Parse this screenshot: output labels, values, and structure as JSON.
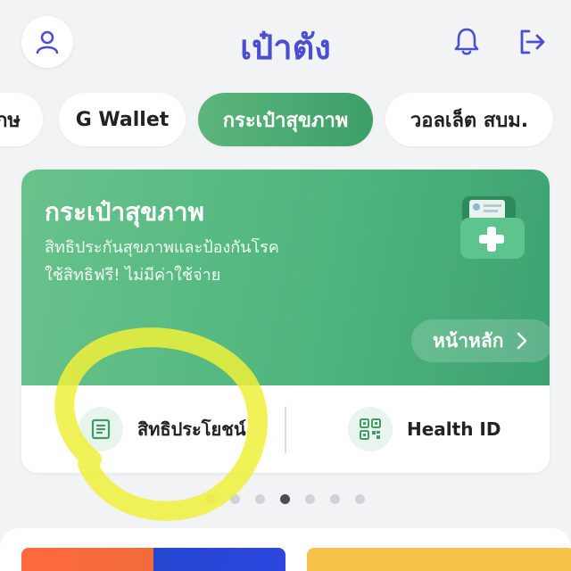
{
  "header": {
    "title": "เป๋าตัง"
  },
  "tabs": [
    {
      "label": "กษ"
    },
    {
      "label": "G Wallet"
    },
    {
      "label": "กระเป๋าสุขภาพ"
    },
    {
      "label": "วอลเล็ต สบม."
    }
  ],
  "hero": {
    "title": "กระเป๋าสุขภาพ",
    "subtitle_line1": "สิทธิประกันสุขภาพและป้องกันโรค",
    "subtitle_line2": "ใช้สิทธิฟรี! ไม่มีค่าใช้จ่าย",
    "home_button": "หน้าหลัก"
  },
  "quick_actions": [
    {
      "label": "สิทธิประโยชน์",
      "icon": "document-icon"
    },
    {
      "label": "Health ID",
      "icon": "qr-code-icon"
    }
  ],
  "pagination": {
    "count": 7,
    "active_index": 3
  },
  "colors": {
    "accent": "#4a4fd1",
    "green": "#4fb67e",
    "annotation": "#eef03a"
  }
}
